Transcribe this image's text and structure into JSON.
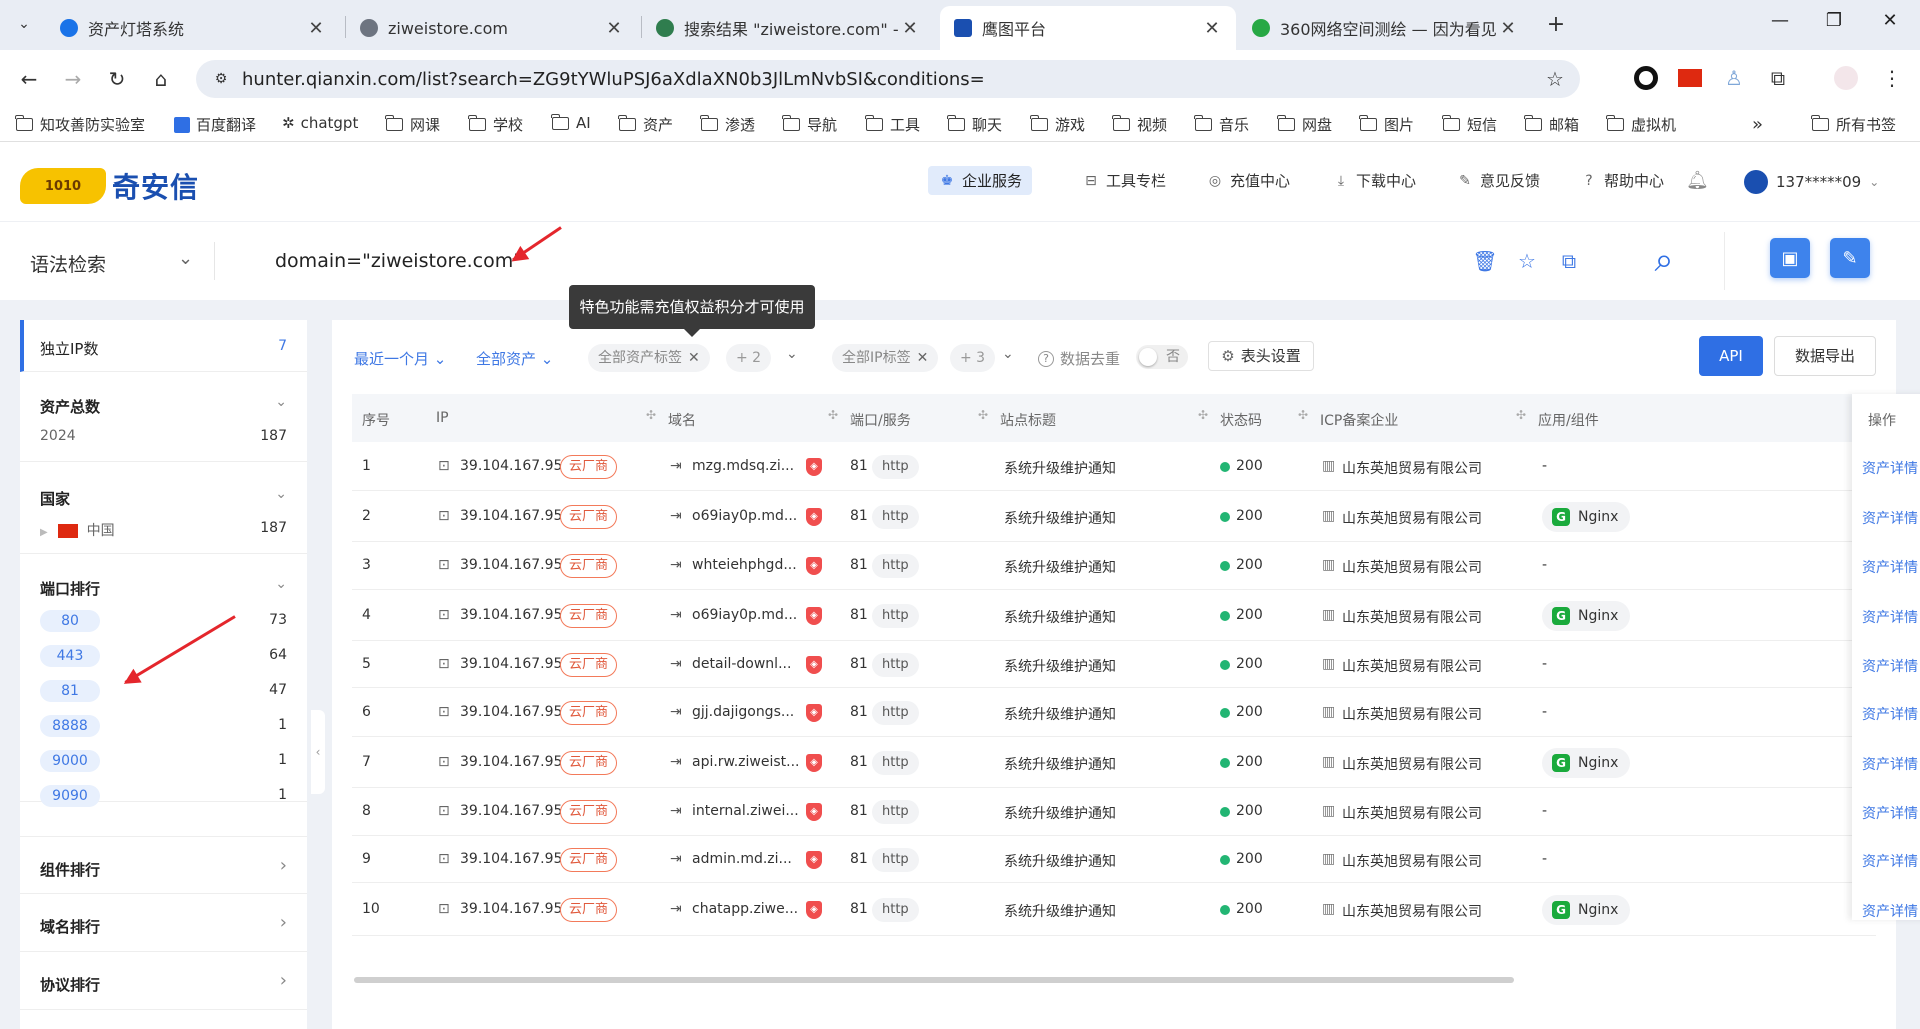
{
  "browser": {
    "tabs": [
      {
        "title": "资产灯塔系统",
        "color": "#1a73e8"
      },
      {
        "title": "ziweistore.com",
        "color": "#6d7480"
      },
      {
        "title": "搜索结果 \"ziweistore.com\" - 网",
        "color": "#2f7d4e"
      },
      {
        "title": "鹰图平台",
        "color": "#1a4fb0"
      },
      {
        "title": "360网络空间测绘 — 因为看见",
        "color": "#27a844"
      }
    ],
    "url": "hunter.qianxin.com/list?search=ZG9tYWluPSJ6aXdlaXN0b3JlLmNvbSI&conditions=",
    "bookmarks": [
      "知攻善防实验室",
      "百度翻译",
      "chatgpt",
      "网课",
      "学校",
      "AI",
      "资产",
      "渗透",
      "导航",
      "工具",
      "聊天",
      "游戏",
      "视频",
      "音乐",
      "网盘",
      "图片",
      "短信",
      "邮箱",
      "虚拟机"
    ],
    "all_bookmarks": "所有书签"
  },
  "header": {
    "logo_mark": "1010",
    "logo_text": "奇安信",
    "nav": [
      "企业服务",
      "工具专栏",
      "充值中心",
      "下载中心",
      "意见反馈",
      "帮助中心"
    ],
    "user": "137*****09"
  },
  "search": {
    "type": "语法检索",
    "query": "domain=\"ziweistore.com\""
  },
  "tooltip": "特色功能需充值权益积分才可使用",
  "sidebar": {
    "unique_ip": {
      "label": "独立IP数",
      "value": "7"
    },
    "total_assets": {
      "label": "资产总数",
      "year": "2024",
      "value": "187"
    },
    "country": {
      "label": "国家",
      "name": "中国",
      "value": "187"
    },
    "ports": {
      "label": "端口排行",
      "items": [
        {
          "port": "80",
          "count": "73"
        },
        {
          "port": "443",
          "count": "64"
        },
        {
          "port": "81",
          "count": "47"
        },
        {
          "port": "8888",
          "count": "1"
        },
        {
          "port": "9000",
          "count": "1"
        },
        {
          "port": "9090",
          "count": "1"
        }
      ]
    },
    "components": "组件排行",
    "domains": "域名排行",
    "protocols": "协议排行"
  },
  "filters": {
    "time": "最近一个月",
    "assets": "全部资产",
    "asset_tags": "全部资产标签",
    "asset_tags_more": "+ 2",
    "ip_tags": "全部IP标签",
    "ip_tags_more": "+ 3",
    "dedup": "数据去重",
    "dedup_state": "否",
    "header_settings": "表头设置",
    "api": "API",
    "export": "数据导出"
  },
  "table": {
    "columns": [
      "序号",
      "IP",
      "域名",
      "端口/服务",
      "站点标题",
      "状态码",
      "ICP备案企业",
      "应用/组件",
      "操作"
    ],
    "rows": [
      {
        "no": "1",
        "ip": "39.104.167.95",
        "tag": "云厂商",
        "domain": "mzg.mdsq.zi...",
        "port": "81",
        "service": "http",
        "title": "系统升级维护通知",
        "status": "200",
        "icp": "山东英旭贸易有限公司",
        "component": "-",
        "action": "资产详情"
      },
      {
        "no": "2",
        "ip": "39.104.167.95",
        "tag": "云厂商",
        "domain": "o69iay0p.md...",
        "port": "81",
        "service": "http",
        "title": "系统升级维护通知",
        "status": "200",
        "icp": "山东英旭贸易有限公司",
        "component": "Nginx",
        "action": "资产详情"
      },
      {
        "no": "3",
        "ip": "39.104.167.95",
        "tag": "云厂商",
        "domain": "whteiehphgd...",
        "port": "81",
        "service": "http",
        "title": "系统升级维护通知",
        "status": "200",
        "icp": "山东英旭贸易有限公司",
        "component": "-",
        "action": "资产详情"
      },
      {
        "no": "4",
        "ip": "39.104.167.95",
        "tag": "云厂商",
        "domain": "o69iay0p.md...",
        "port": "81",
        "service": "http",
        "title": "系统升级维护通知",
        "status": "200",
        "icp": "山东英旭贸易有限公司",
        "component": "Nginx",
        "action": "资产详情"
      },
      {
        "no": "5",
        "ip": "39.104.167.95",
        "tag": "云厂商",
        "domain": "detail-downl...",
        "port": "81",
        "service": "http",
        "title": "系统升级维护通知",
        "status": "200",
        "icp": "山东英旭贸易有限公司",
        "component": "-",
        "action": "资产详情"
      },
      {
        "no": "6",
        "ip": "39.104.167.95",
        "tag": "云厂商",
        "domain": "gjj.dajigongs...",
        "port": "81",
        "service": "http",
        "title": "系统升级维护通知",
        "status": "200",
        "icp": "山东英旭贸易有限公司",
        "component": "-",
        "action": "资产详情"
      },
      {
        "no": "7",
        "ip": "39.104.167.95",
        "tag": "云厂商",
        "domain": "api.rw.ziweist...",
        "port": "81",
        "service": "http",
        "title": "系统升级维护通知",
        "status": "200",
        "icp": "山东英旭贸易有限公司",
        "component": "Nginx",
        "action": "资产详情"
      },
      {
        "no": "8",
        "ip": "39.104.167.95",
        "tag": "云厂商",
        "domain": "internal.ziwei...",
        "port": "81",
        "service": "http",
        "title": "系统升级维护通知",
        "status": "200",
        "icp": "山东英旭贸易有限公司",
        "component": "-",
        "action": "资产详情"
      },
      {
        "no": "9",
        "ip": "39.104.167.95",
        "tag": "云厂商",
        "domain": "admin.md.zi...",
        "port": "81",
        "service": "http",
        "title": "系统升级维护通知",
        "status": "200",
        "icp": "山东英旭贸易有限公司",
        "component": "-",
        "action": "资产详情"
      },
      {
        "no": "10",
        "ip": "39.104.167.95",
        "tag": "云厂商",
        "domain": "chatapp.ziwe...",
        "port": "81",
        "service": "http",
        "title": "系统升级维护通知",
        "status": "200",
        "icp": "山东英旭贸易有限公司",
        "component": "Nginx",
        "action": "资产详情"
      }
    ]
  }
}
